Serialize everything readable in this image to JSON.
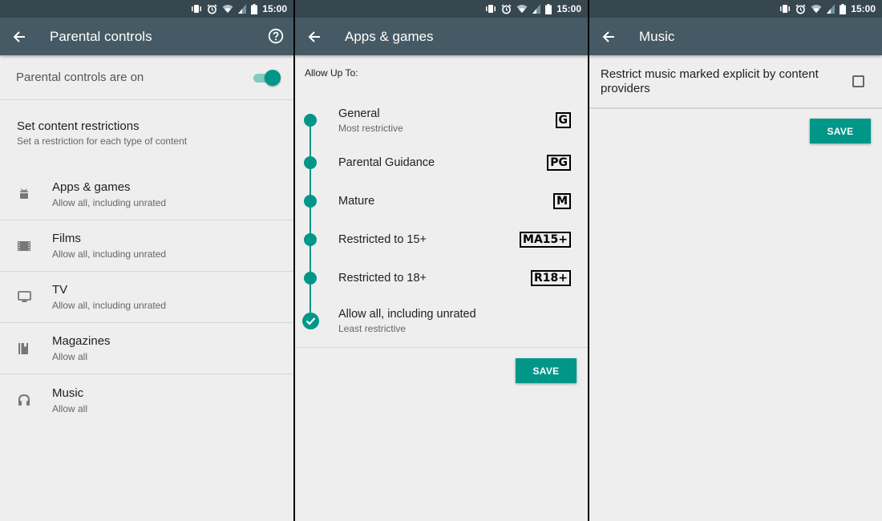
{
  "status_bar": {
    "time": "15:00",
    "icons": [
      "vibrate-icon",
      "alarm-icon",
      "wifi-icon",
      "signal-icon",
      "battery-icon"
    ]
  },
  "colors": {
    "accent": "#009688",
    "accent_light": "#80cbc4",
    "appbar": "#455a64",
    "statusbar": "#37474f",
    "background": "#eeeeee"
  },
  "parental_controls": {
    "title": "Parental controls",
    "help_icon": "help-circle-icon",
    "toggle": {
      "label": "Parental controls are on",
      "on": true
    },
    "section": {
      "title": "Set content restrictions",
      "subtitle": "Set a restriction for each type of content"
    },
    "categories": [
      {
        "icon": "android-icon",
        "label": "Apps & games",
        "value": "Allow all, including unrated"
      },
      {
        "icon": "film-icon",
        "label": "Films",
        "value": "Allow all, including unrated"
      },
      {
        "icon": "tv-icon",
        "label": "TV",
        "value": "Allow all, including unrated"
      },
      {
        "icon": "magazine-icon",
        "label": "Magazines",
        "value": "Allow all"
      },
      {
        "icon": "headphones-icon",
        "label": "Music",
        "value": "Allow all"
      }
    ]
  },
  "apps_games": {
    "title": "Apps & games",
    "allow_label": "Allow Up To:",
    "ratings": [
      {
        "label": "General",
        "sub": "Most restrictive",
        "badge": "G",
        "selected": false
      },
      {
        "label": "Parental Guidance",
        "sub": "",
        "badge": "PG",
        "selected": false
      },
      {
        "label": "Mature",
        "sub": "",
        "badge": "M",
        "selected": false
      },
      {
        "label": "Restricted to 15+",
        "sub": "",
        "badge": "MA15+",
        "selected": false
      },
      {
        "label": "Restricted to 18+",
        "sub": "",
        "badge": "R18+",
        "selected": false
      },
      {
        "label": "Allow all, including unrated",
        "sub": "Least restrictive",
        "badge": "",
        "selected": true
      }
    ],
    "save_label": "SAVE"
  },
  "music": {
    "title": "Music",
    "explicit_label": "Restrict music marked explicit by content providers",
    "explicit_checked": false,
    "save_label": "SAVE"
  }
}
